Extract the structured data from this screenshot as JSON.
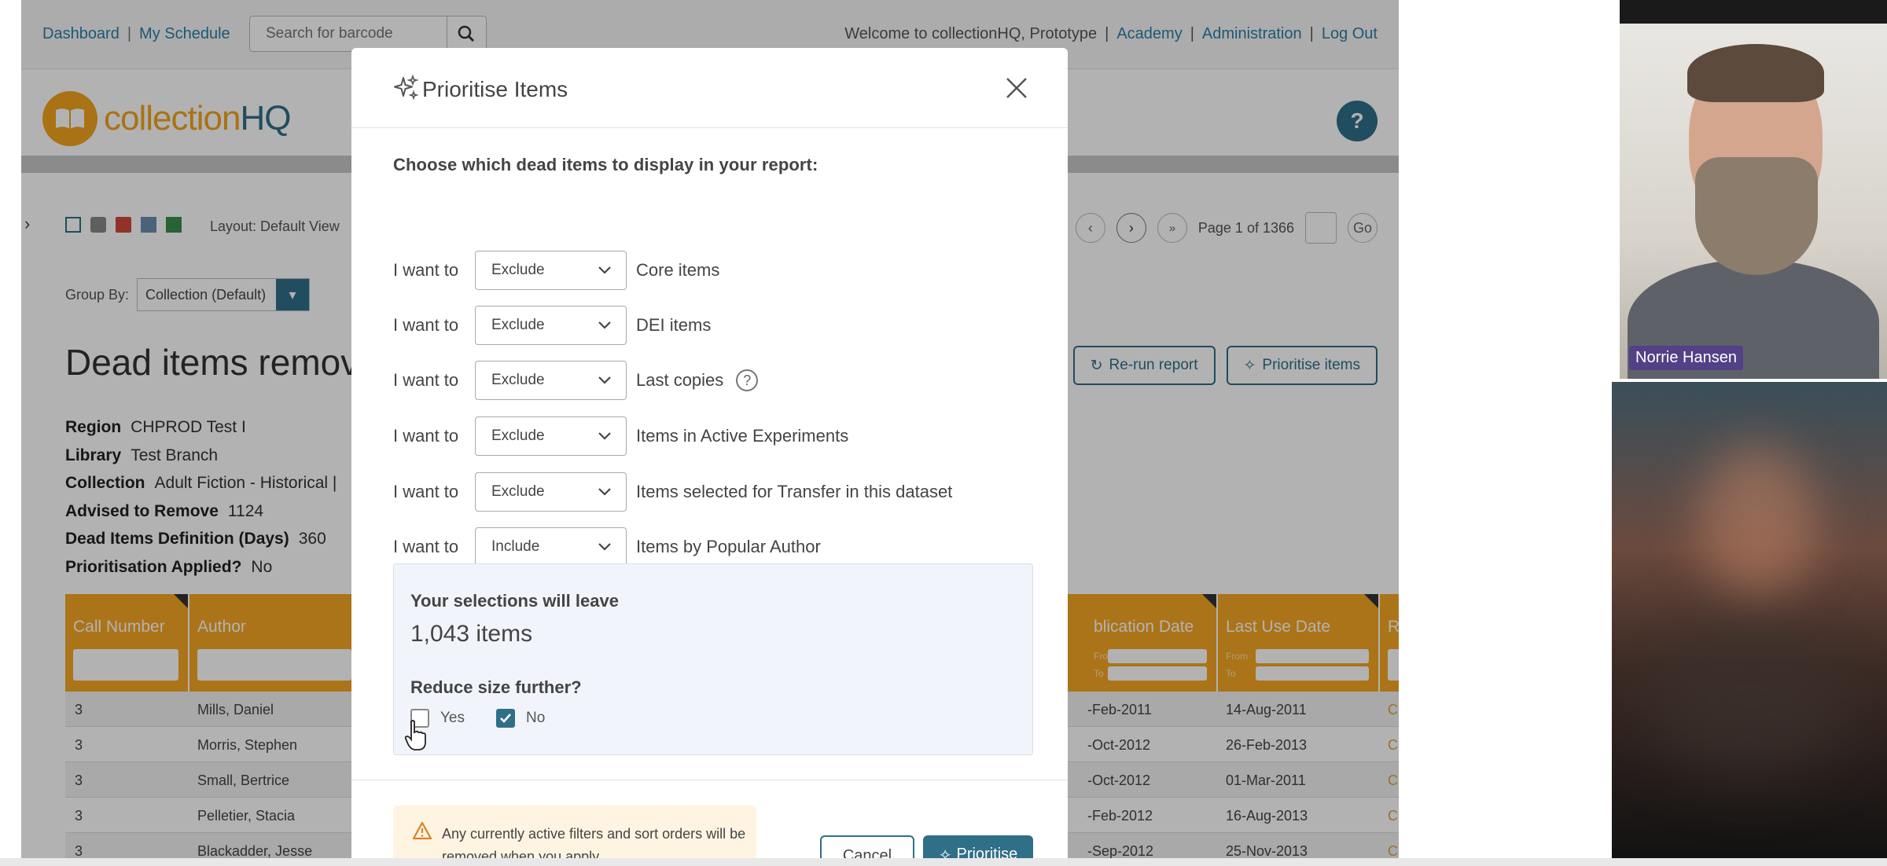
{
  "topbar": {
    "links": [
      "Dashboard",
      "My Schedule"
    ],
    "search_placeholder": "Search for barcode",
    "welcome": "Welcome to collectionHQ, Prototype",
    "right_links": [
      "Academy",
      "Administration",
      "Log Out"
    ]
  },
  "brand": {
    "name_part1": "collection",
    "name_part2": "HQ",
    "help": "?"
  },
  "toolbar": {
    "layout_label": "Layout: Default View",
    "page_label": "Page 1 of 1366",
    "go": "Go"
  },
  "groupby": {
    "label": "Group By:",
    "value": "Collection (Default)"
  },
  "report": {
    "title": "Dead items remova",
    "rerun": "Re-run report",
    "prioritise": "Prioritise items",
    "meta": [
      {
        "label": "Region",
        "value": "CHPROD Test I"
      },
      {
        "label": "Library",
        "value": "Test Branch"
      },
      {
        "label": "Collection",
        "value": "Adult Fiction - Historical |"
      },
      {
        "label": "Advised to Remove",
        "value": "1124"
      },
      {
        "label": "Dead Items Definition (Days)",
        "value": "360"
      },
      {
        "label": "Prioritisation Applied?",
        "value": "No"
      }
    ]
  },
  "grid": {
    "headers": [
      "Call Number",
      "Author",
      "blication Date",
      "Last Use Date",
      "Re"
    ],
    "filter_from": "From",
    "filter_to": "To",
    "rows": [
      {
        "call": "3",
        "author": "Mills, Daniel",
        "pub": "-Feb-2011",
        "last": "14-Aug-2011",
        "re": "Che"
      },
      {
        "call": "3",
        "author": "Morris, Stephen",
        "pub": "-Oct-2012",
        "last": "26-Feb-2013",
        "re": "Che"
      },
      {
        "call": "3",
        "author": "Small, Bertrice",
        "pub": "-Oct-2012",
        "last": "01-Mar-2011",
        "re": "Che"
      },
      {
        "call": "3",
        "author": "Pelletier, Stacia",
        "pub": "-Feb-2012",
        "last": "16-Aug-2013",
        "re": "Che"
      },
      {
        "call": "3",
        "author": "Blackadder, Jesse",
        "pub": "-Sep-2012",
        "last": "25-Nov-2013",
        "re": "Che"
      }
    ]
  },
  "modal": {
    "title": "Prioritise Items",
    "intro": "Choose which dead items to display in your report:",
    "i_want_to": "I want to",
    "choices": [
      {
        "action": "Exclude",
        "item": "Core items"
      },
      {
        "action": "Exclude",
        "item": "DEI items"
      },
      {
        "action": "Exclude",
        "item": "Last copies"
      },
      {
        "action": "Exclude",
        "item": "Items in Active Experiments"
      },
      {
        "action": "Exclude",
        "item": "Items selected for Transfer in this dataset"
      },
      {
        "action": "Include",
        "item": "Items by Popular Author"
      }
    ],
    "summary_label": "Your selections will leave",
    "summary_count": "1,043 items",
    "reduce_label": "Reduce size further?",
    "yes": "Yes",
    "no": "No",
    "warning": "Any currently active filters and sort orders will be removed when you apply",
    "cancel": "Cancel",
    "prioritise": "Prioritise"
  },
  "video": {
    "participant_name": "Norrie Hansen"
  },
  "colors": {
    "brand_teal": "#2f6f88",
    "brand_orange": "#f5a623",
    "summary_bg": "#f1f4fa",
    "warning_bg": "#fff4e2"
  }
}
